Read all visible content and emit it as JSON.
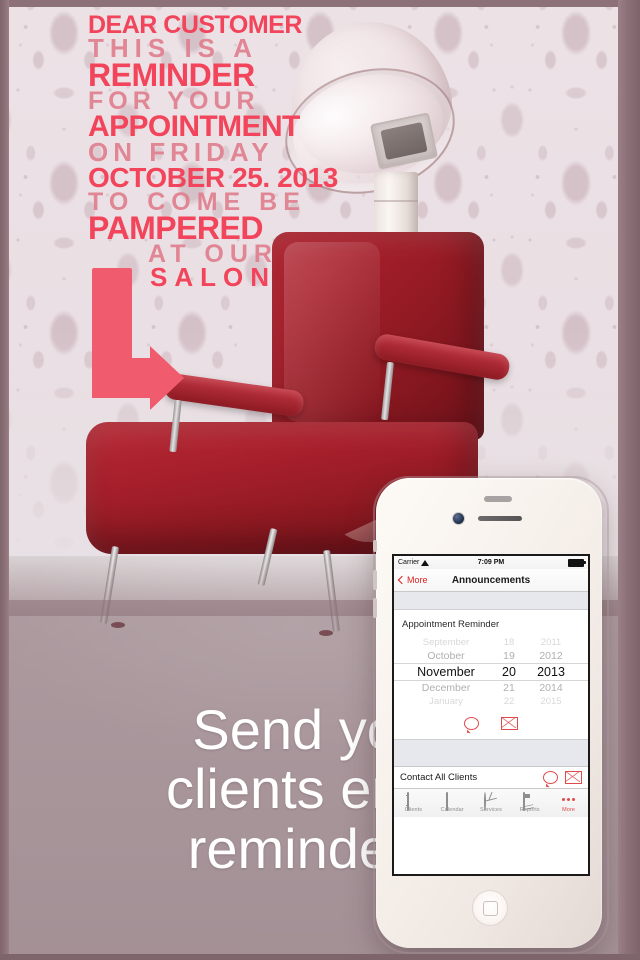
{
  "poster": {
    "lines": [
      {
        "text": "DEAR CUSTOMER",
        "style": "bold"
      },
      {
        "text": "THIS IS A",
        "style": "soft"
      },
      {
        "text": "REMINDER",
        "style": "bold"
      },
      {
        "text": "FOR YOUR",
        "style": "soft"
      },
      {
        "text": "APPOINTMENT",
        "style": "bold"
      },
      {
        "text": "ON FRIDAY",
        "style": "soft"
      },
      {
        "text": "OCTOBER 25. 2013",
        "style": "bold"
      },
      {
        "text": "TO COME BE",
        "style": "soft"
      },
      {
        "text": "PAMPERED",
        "style": "bold"
      },
      {
        "text": "AT OUR",
        "style": "soft"
      },
      {
        "text": "SALON",
        "style": "bold"
      }
    ],
    "arrow_icon": "down-right-arrow-icon"
  },
  "caption": {
    "line1": "Send your",
    "line2": "clients email",
    "line3": "reminders."
  },
  "phone": {
    "status_bar": {
      "carrier": "Carrier",
      "wifi_icon": "wifi-icon",
      "time": "7:09 PM",
      "battery_icon": "battery-full-icon"
    },
    "nav_bar": {
      "back_icon": "chevron-left-icon",
      "back_label": "More",
      "title": "Announcements"
    },
    "card": {
      "title": "Appointment Reminder",
      "picker": {
        "months": [
          "September",
          "October",
          "November",
          "December",
          "January"
        ],
        "days": [
          "18",
          "19",
          "20",
          "21",
          "22"
        ],
        "years": [
          "2011",
          "2012",
          "2013",
          "2014",
          "2015"
        ],
        "selected_index": 2,
        "selected_month": "November",
        "selected_day": "20",
        "selected_year": "2013"
      },
      "actions": [
        {
          "icon": "speech-bubble-icon",
          "name": "send-sms-button"
        },
        {
          "icon": "envelope-icon",
          "name": "send-email-button"
        }
      ]
    },
    "contact_bar": {
      "label": "Contact All Clients",
      "actions": [
        {
          "icon": "speech-bubble-icon",
          "name": "contact-all-sms-button"
        },
        {
          "icon": "envelope-icon",
          "name": "contact-all-email-button"
        }
      ]
    },
    "tab_bar": {
      "items": [
        {
          "label": "Clients",
          "icon": "address-book-icon",
          "active": false
        },
        {
          "label": "Calendar",
          "icon": "calendar-icon",
          "active": false
        },
        {
          "label": "Services",
          "icon": "scissors-circle-icon",
          "active": false
        },
        {
          "label": "Reports",
          "icon": "chart-document-icon",
          "active": false
        },
        {
          "label": "More",
          "icon": "ellipsis-icon",
          "active": true
        }
      ]
    }
  },
  "colors": {
    "accent_red": "#f2445a",
    "soft_pink": "#e07f8e",
    "ios_red": "#e04a4a",
    "chair_red": "#a81f2b",
    "wall_mauve": "#8d7178"
  },
  "scene": {
    "hair_dryer": "vintage-salon-hair-dryer",
    "chair": "red-leather-salon-chair",
    "wallpaper": "damask-pattern-wallpaper"
  }
}
